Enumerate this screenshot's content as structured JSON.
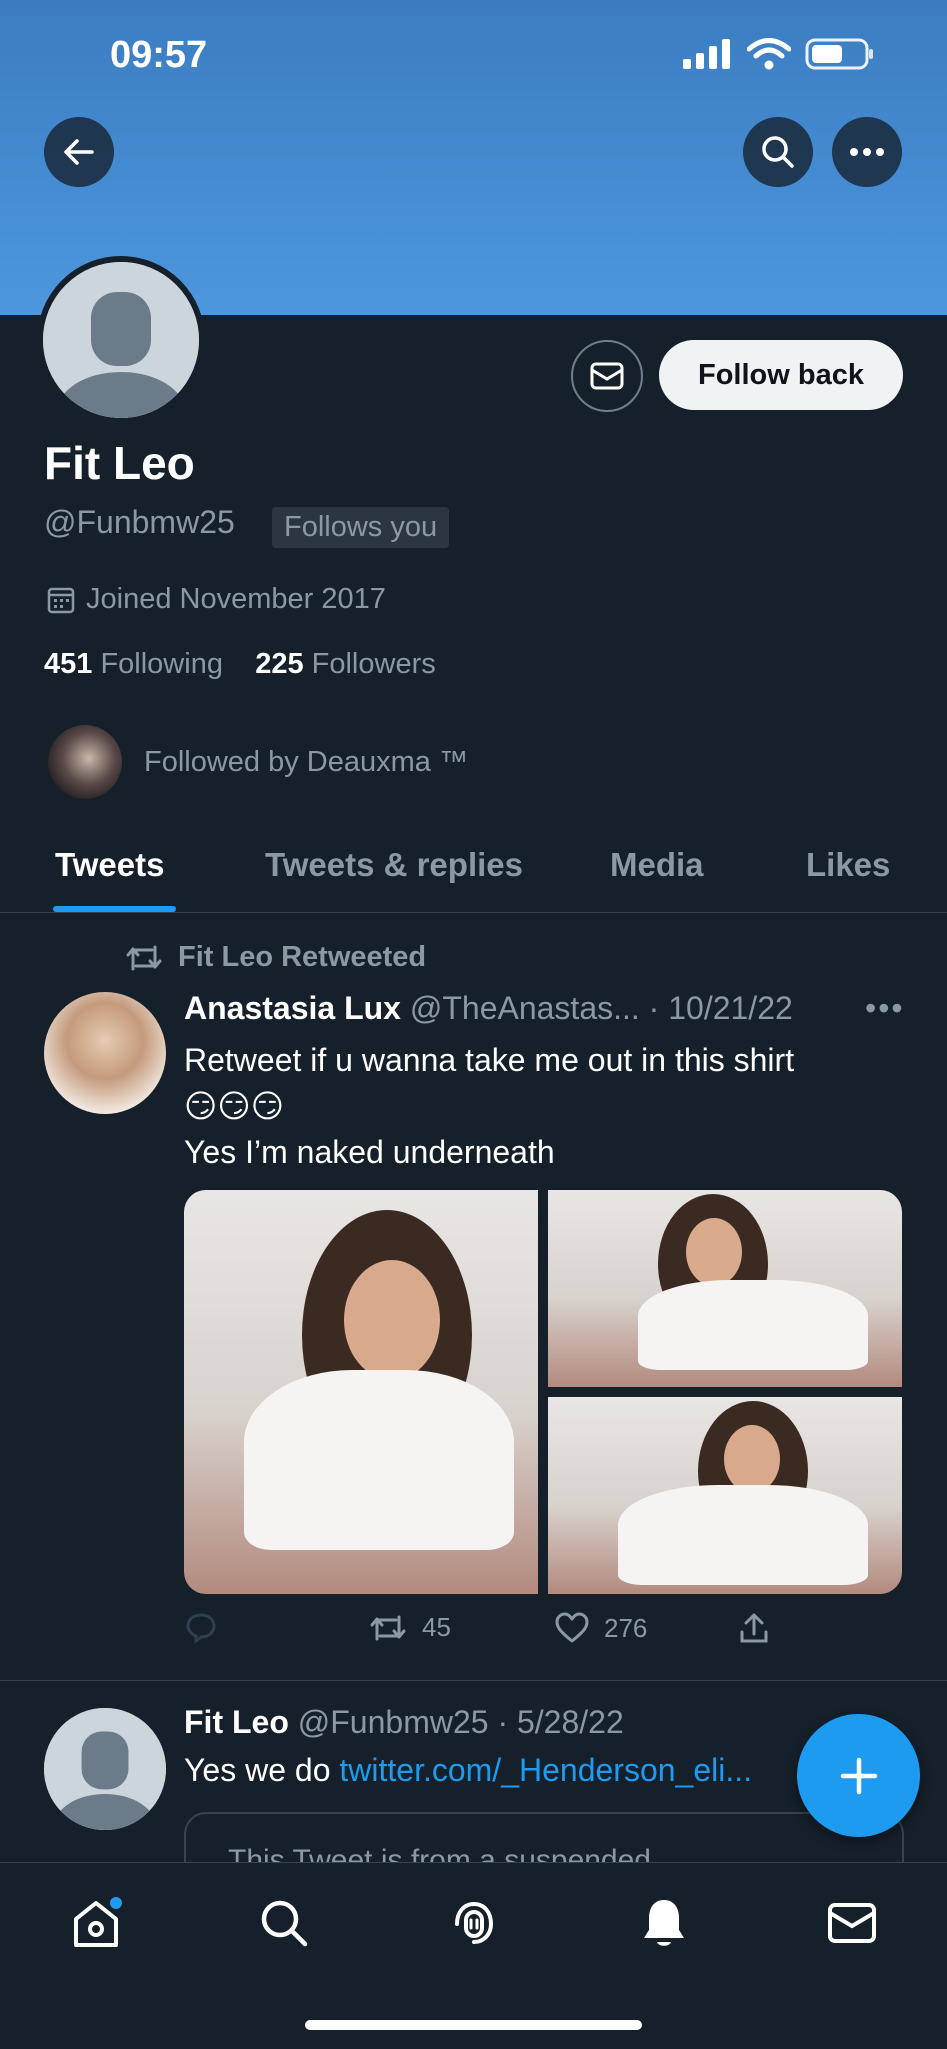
{
  "status_bar": {
    "time": "09:57"
  },
  "header": {
    "back_icon": "arrow-left-icon",
    "search_icon": "search-icon",
    "more_icon": "more-horizontal-icon",
    "banner_color": "#4d97de"
  },
  "profile": {
    "name": "Fit Leo",
    "handle": "@Funbmw25",
    "follows_you": "Follows you",
    "joined": "Joined November 2017",
    "following_count": "451",
    "following_label": "Following",
    "followers_count": "225",
    "followers_label": "Followers",
    "followed_by": "Followed by Deauxma ™",
    "follow_button": "Follow back",
    "message_icon": "mail-icon"
  },
  "tabs": [
    {
      "label": "Tweets",
      "active": true
    },
    {
      "label": "Tweets & replies",
      "active": false
    },
    {
      "label": "Media",
      "active": false
    },
    {
      "label": "Likes",
      "active": false
    }
  ],
  "tweets": [
    {
      "retweeted_by": "Fit Leo Retweeted",
      "author_name": "Anastasia Lux",
      "author_handle": "@TheAnastas...",
      "date": "· 10/21/22",
      "text_line1": "Retweet if u wanna take me out in this shirt",
      "emoji": "😏😏😏",
      "text_line2": "Yes I’m naked underneath",
      "retweets": "45",
      "likes": "276"
    },
    {
      "author_name": "Fit Leo",
      "author_handle": "@Funbmw25",
      "date": "· 5/28/22",
      "text": "Yes we do ",
      "link": "twitter.com/_Henderson_eli...",
      "quote_notice": "This Tweet is from a suspended"
    }
  ],
  "colors": {
    "accent": "#1d9bf0",
    "background": "#15202b",
    "muted": "#8b98a5"
  }
}
